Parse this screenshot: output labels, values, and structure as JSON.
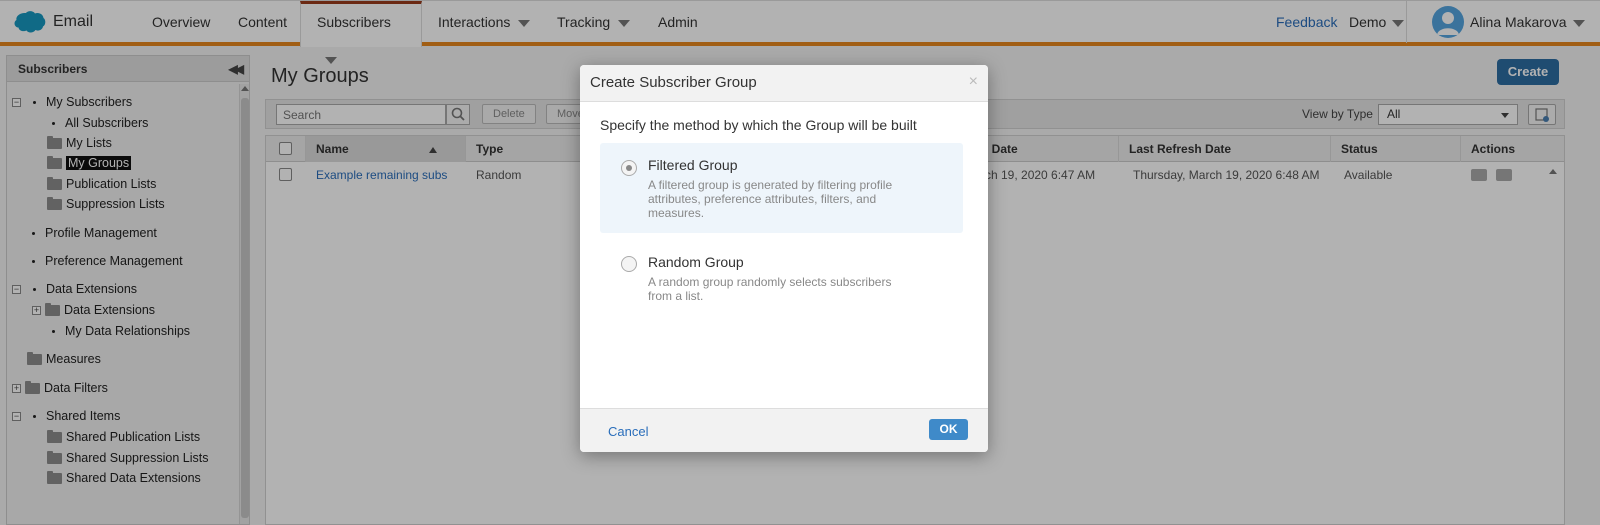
{
  "app": {
    "name": "Email"
  },
  "nav": {
    "items": [
      {
        "label": "Overview"
      },
      {
        "label": "Content"
      },
      {
        "label": "Subscribers"
      },
      {
        "label": "Interactions"
      },
      {
        "label": "Tracking"
      },
      {
        "label": "Admin"
      }
    ],
    "feedback": "Feedback",
    "account": "Demo",
    "user": "Alina Makarova"
  },
  "sidebar": {
    "title": "Subscribers",
    "tree": [
      {
        "label": "My Subscribers"
      },
      {
        "label": "All Subscribers"
      },
      {
        "label": "My Lists"
      },
      {
        "label": "My Groups"
      },
      {
        "label": "Publication Lists"
      },
      {
        "label": "Suppression Lists"
      },
      {
        "label": "Profile Management"
      },
      {
        "label": "Preference Management"
      },
      {
        "label": "Data Extensions"
      },
      {
        "label": "Data Extensions"
      },
      {
        "label": "My Data Relationships"
      },
      {
        "label": "Measures"
      },
      {
        "label": "Data Filters"
      },
      {
        "label": "Shared Items"
      },
      {
        "label": "Shared Publication Lists"
      },
      {
        "label": "Shared Suppression Lists"
      },
      {
        "label": "Shared Data Extensions"
      }
    ]
  },
  "main": {
    "title": "My Groups",
    "create_label": "Create",
    "toolbar": {
      "search_placeholder": "Search",
      "delete_label": "Delete",
      "move_label": "Move",
      "viewby_label": "View by Type",
      "viewby_value": "All"
    },
    "grid": {
      "columns": [
        "Name",
        "Type",
        "d Date",
        "Last Refresh Date",
        "Status",
        "Actions"
      ],
      "rows": [
        {
          "name": "Example remaining subs",
          "type": "Random",
          "created": "rch 19, 2020 6:47 AM",
          "last_refresh": "Thursday, March 19, 2020 6:48 AM",
          "status": "Available"
        }
      ]
    }
  },
  "modal": {
    "title": "Create Subscriber Group",
    "close": "×",
    "instruction": "Specify the method by which the Group will be built",
    "options": [
      {
        "title": "Filtered Group",
        "description": "A filtered group is generated by filtering profile attributes, preference attributes, filters, and measures.",
        "selected": true
      },
      {
        "title": "Random Group",
        "description": "A random group randomly selects subscribers from a list.",
        "selected": false
      }
    ],
    "cancel_label": "Cancel",
    "ok_label": "OK"
  },
  "colors": {
    "accent_bar": "#e7871e",
    "brand_blue": "#1798c1",
    "link": "#2a6ebb",
    "primary_button": "#2d6da3"
  }
}
